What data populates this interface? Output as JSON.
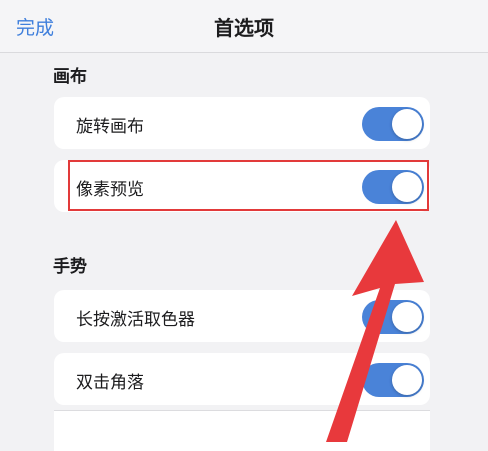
{
  "nav": {
    "done_label": "完成",
    "title": "首选项"
  },
  "sections": [
    {
      "header": "画布",
      "rows": [
        {
          "label": "旋转画布",
          "toggle_on": true
        },
        {
          "label": "像素预览",
          "toggle_on": true
        }
      ]
    },
    {
      "header": "手势",
      "rows": [
        {
          "label": "长按激活取色器",
          "toggle_on": true
        },
        {
          "label": "双击角落",
          "toggle_on": true
        }
      ]
    }
  ],
  "colors": {
    "accent": "#3f7fdc",
    "toggle_on": "#4a83d8",
    "highlight": "#e23a3a",
    "arrow": "#e8393c"
  }
}
